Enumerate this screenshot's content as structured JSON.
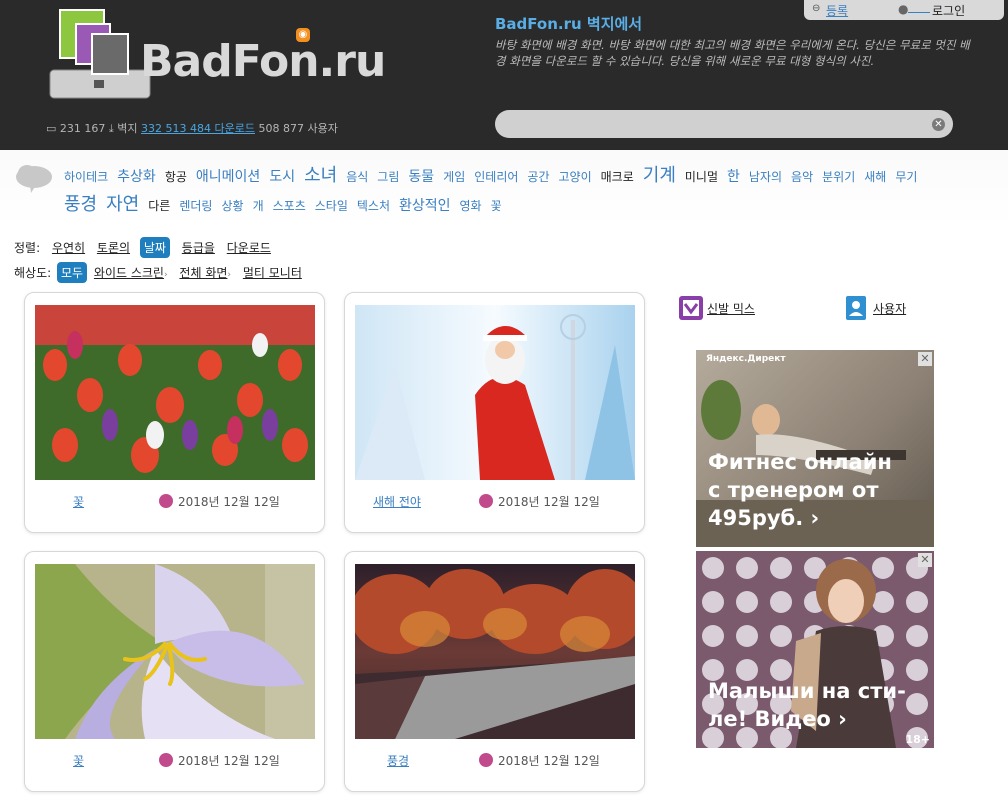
{
  "header": {
    "logo_text": "BadFon.ru",
    "stats": {
      "wallpapers_count": "231 167",
      "downloads_label": "벽지",
      "downloads_count": "332 513 484 다운로드",
      "users": "508 877 사용자"
    },
    "tagline_title": "BadFon.ru 벽지에서",
    "tagline_text": "바탕 화면에 배경 화면. 바탕 화면에 대한 최고의 배경 화면은 우리에게 온다. 당신은 무료로 멋진 배경 화면을 다운로드 할 수 있습니다. 당신을 위해 새로운 무료 대형 형식의 사진.",
    "register_label": "등록",
    "login_label": "로그인",
    "search_placeholder": ""
  },
  "categories": [
    {
      "label": "하이테크",
      "size": "small",
      "color": "blue"
    },
    {
      "label": "추상화",
      "size": "medium",
      "color": "blue"
    },
    {
      "label": "항공",
      "size": "small",
      "color": "dark"
    },
    {
      "label": "애니메이션",
      "size": "medium",
      "color": "blue"
    },
    {
      "label": "도시",
      "size": "medium",
      "color": "blue"
    },
    {
      "label": "소녀",
      "size": "large",
      "color": "blue"
    },
    {
      "label": "음식",
      "size": "small",
      "color": "blue"
    },
    {
      "label": "그림",
      "size": "small",
      "color": "blue"
    },
    {
      "label": "동물",
      "size": "medium",
      "color": "blue"
    },
    {
      "label": "게임",
      "size": "small",
      "color": "blue"
    },
    {
      "label": "인테리어",
      "size": "small",
      "color": "blue"
    },
    {
      "label": "공간",
      "size": "small",
      "color": "blue"
    },
    {
      "label": "고양이",
      "size": "small",
      "color": "blue"
    },
    {
      "label": "매크로",
      "size": "small",
      "color": "dark"
    },
    {
      "label": "기계",
      "size": "large",
      "color": "blue"
    },
    {
      "label": "미니멀",
      "size": "small",
      "color": "dark"
    },
    {
      "label": "한",
      "size": "medium",
      "color": "blue"
    },
    {
      "label": "남자의",
      "size": "small",
      "color": "blue"
    },
    {
      "label": "음악",
      "size": "small",
      "color": "blue"
    },
    {
      "label": "분위기",
      "size": "small",
      "color": "blue"
    },
    {
      "label": "새해",
      "size": "small",
      "color": "blue"
    },
    {
      "label": "무기",
      "size": "small",
      "color": "blue"
    },
    {
      "label": "풍경",
      "size": "large",
      "color": "blue"
    },
    {
      "label": "자연",
      "size": "large",
      "color": "blue"
    },
    {
      "label": "다른",
      "size": "small",
      "color": "dark"
    },
    {
      "label": "렌더링",
      "size": "small",
      "color": "blue"
    },
    {
      "label": "상황",
      "size": "small",
      "color": "blue"
    },
    {
      "label": "개",
      "size": "small",
      "color": "blue"
    },
    {
      "label": "스포츠",
      "size": "small",
      "color": "blue"
    },
    {
      "label": "스타일",
      "size": "small",
      "color": "blue"
    },
    {
      "label": "텍스처",
      "size": "small",
      "color": "blue"
    },
    {
      "label": "환상적인",
      "size": "medium",
      "color": "blue"
    },
    {
      "label": "영화",
      "size": "small",
      "color": "blue"
    },
    {
      "label": "꽃",
      "size": "small",
      "color": "blue"
    }
  ],
  "sort": {
    "label": "정렬:",
    "options": [
      "우연히",
      "토론의",
      "날짜",
      "등급을",
      "다운로드"
    ],
    "active": "날짜"
  },
  "resolution": {
    "label": "해상도:",
    "options": [
      "모두",
      "와이드 스크린",
      "전체 화면",
      "멀티 모니터"
    ],
    "active": "모두"
  },
  "cards": [
    {
      "tag": "꽃",
      "date": "2018년 12월 12일"
    },
    {
      "tag": "새해 전야",
      "date": "2018년 12월 12일"
    },
    {
      "tag": "꽃",
      "date": "2018년 12월 12일"
    },
    {
      "tag": "풍경",
      "date": "2018년 12월 12일"
    }
  ],
  "sidebar": {
    "mix_label": "신발 믹스",
    "users_label": "사용자"
  },
  "ads": {
    "brand": "Яндекс.Директ",
    "ad1_text": "Фитнес онлайн с тренером от 495руб. ›",
    "ad2_text": "Малыши на сти- ле! Видео ›",
    "age": "18+"
  },
  "colors": {
    "header_bg": "#2a2a2b",
    "link": "#3a7fc1",
    "accent": "#1f7fbe",
    "date_icon": "#c14a8c"
  }
}
